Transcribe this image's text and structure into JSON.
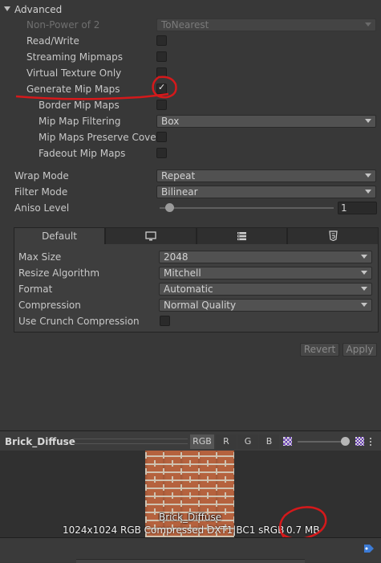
{
  "advanced": {
    "header": "Advanced",
    "non_power_of_2": {
      "label": "Non-Power of 2",
      "value": "ToNearest"
    },
    "read_write": {
      "label": "Read/Write",
      "checked": false
    },
    "streaming_mipmaps": {
      "label": "Streaming Mipmaps",
      "checked": false
    },
    "virtual_texture_only": {
      "label": "Virtual Texture Only",
      "checked": false
    },
    "generate_mip_maps": {
      "label": "Generate Mip Maps",
      "checked": true
    },
    "border_mip_maps": {
      "label": "Border Mip Maps",
      "checked": false
    },
    "mip_map_filtering": {
      "label": "Mip Map Filtering",
      "value": "Box"
    },
    "mip_maps_preserve_coverage": {
      "label": "Mip Maps Preserve Cover",
      "checked": false
    },
    "fadeout_mip_maps": {
      "label": "Fadeout Mip Maps",
      "checked": false
    }
  },
  "wrap_mode": {
    "label": "Wrap Mode",
    "value": "Repeat"
  },
  "filter_mode": {
    "label": "Filter Mode",
    "value": "Bilinear"
  },
  "aniso_level": {
    "label": "Aniso Level",
    "value": "1"
  },
  "platform_tabs": [
    {
      "label": "Default",
      "icon": "none"
    },
    {
      "label": "",
      "icon": "monitor-icon"
    },
    {
      "label": "",
      "icon": "server-icon"
    },
    {
      "label": "",
      "icon": "html5-icon"
    }
  ],
  "platform_settings": {
    "max_size": {
      "label": "Max Size",
      "value": "2048"
    },
    "resize_algorithm": {
      "label": "Resize Algorithm",
      "value": "Mitchell"
    },
    "format": {
      "label": "Format",
      "value": "Automatic"
    },
    "compression": {
      "label": "Compression",
      "value": "Normal Quality"
    },
    "use_crunch_compression": {
      "label": "Use Crunch Compression",
      "checked": false
    }
  },
  "actions": {
    "revert": "Revert",
    "apply": "Apply"
  },
  "preview": {
    "asset_name": "Brick_Diffuse",
    "channels": [
      "RGB",
      "R",
      "G",
      "B"
    ],
    "texture_label": "Brick_Diffuse",
    "info_text": "1024x1024  RGB Compressed DXT1|BC1 sRGB",
    "size_text": "0.7 MB"
  },
  "colors": {
    "background": "#383838",
    "annotation": "#d4191b",
    "brick": "#b5623e",
    "mortar": "#cfc2b0",
    "tag_icon": "#3c7bd6"
  }
}
